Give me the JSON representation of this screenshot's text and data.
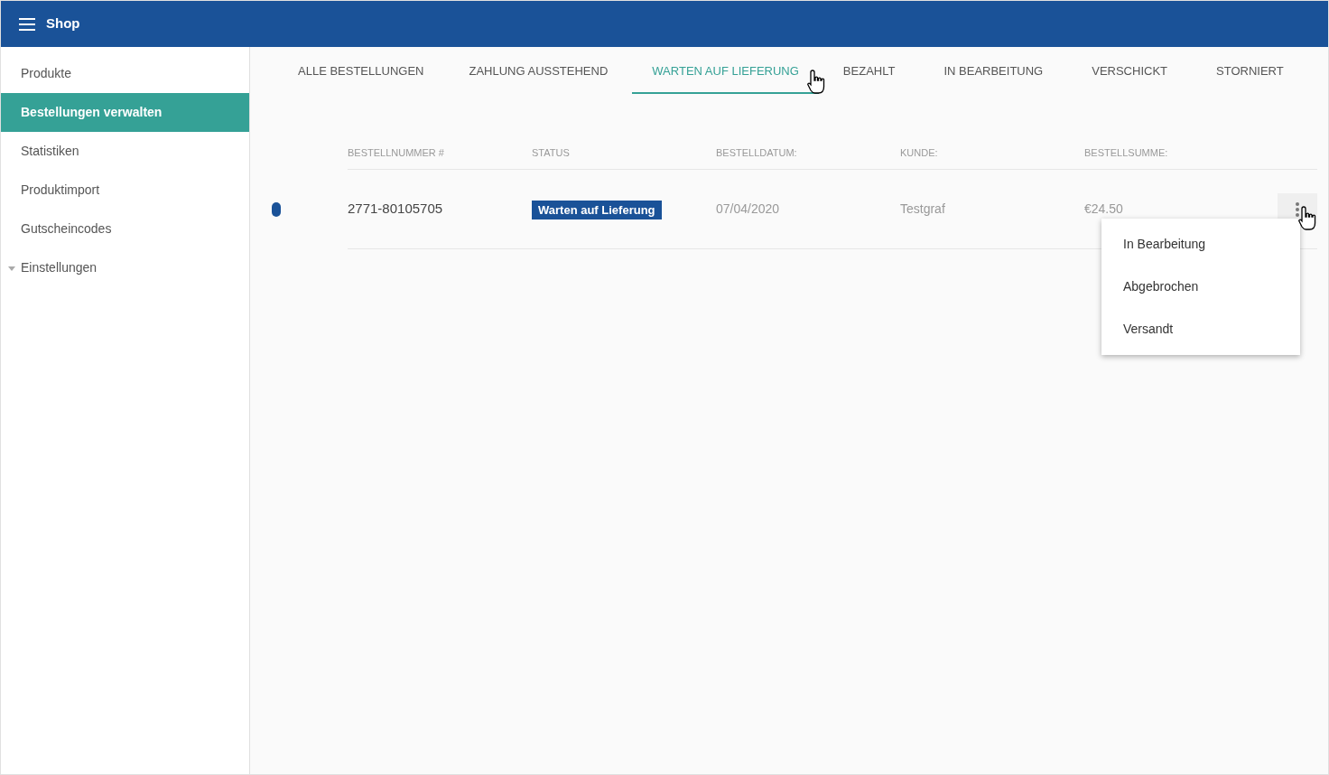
{
  "app_bar": {
    "title": "Shop"
  },
  "sidebar": {
    "items": [
      {
        "label": "Produkte",
        "selected": false,
        "kind": "link"
      },
      {
        "label": "Bestellungen verwalten",
        "selected": true,
        "kind": "link"
      },
      {
        "label": "Statistiken",
        "selected": false,
        "kind": "link"
      },
      {
        "label": "Produktimport",
        "selected": false,
        "kind": "link"
      },
      {
        "label": "Gutscheincodes",
        "selected": false,
        "kind": "link"
      },
      {
        "label": "Einstellungen",
        "selected": false,
        "kind": "group"
      }
    ]
  },
  "tabs": [
    {
      "label": "ALLE BESTELLUNGEN",
      "selected": false
    },
    {
      "label": "ZAHLUNG AUSSTEHEND",
      "selected": false
    },
    {
      "label": "WARTEN AUF LIEFERUNG",
      "selected": true
    },
    {
      "label": "BEZAHLT",
      "selected": false
    },
    {
      "label": "IN BEARBEITUNG",
      "selected": false
    },
    {
      "label": "VERSCHICKT",
      "selected": false
    },
    {
      "label": "STORNIERT",
      "selected": false
    }
  ],
  "table": {
    "columns": [
      "BESTELLNUMMER #",
      "STATUS",
      "BESTELLDATUM:",
      "KUNDE:",
      "BESTELLSUMME:"
    ],
    "rows": [
      {
        "color": "#1a5298",
        "order_number": "2771-80105705",
        "status": "Warten auf Lieferung",
        "date": "07/04/2020",
        "customer": "Testgraf",
        "total": "€24.50"
      }
    ]
  },
  "row_menu": {
    "open": true,
    "items": [
      "In Bearbeitung",
      "Abgebrochen",
      "Versandt"
    ]
  }
}
